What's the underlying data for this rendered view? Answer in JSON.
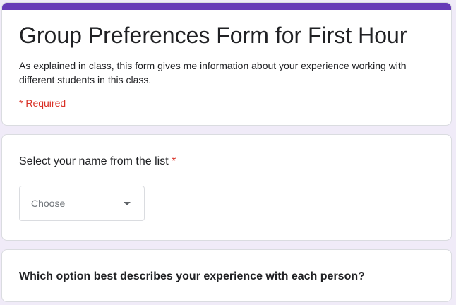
{
  "header": {
    "title": "Group Preferences Form for First Hour",
    "description": "As explained in class, this form gives me information about your experience working with different students in this class.",
    "required_note": "* Required"
  },
  "question_name": {
    "label": "Select your name from the list",
    "required_marker": "*",
    "dropdown_value": "Choose"
  },
  "question_experience": {
    "label": "Which option best describes your experience with each person?"
  },
  "colors": {
    "accent": "#673ab7",
    "background": "#f0ebf8",
    "required": "#d93025"
  },
  "icons": {
    "dropdown": "chevron-down-icon"
  }
}
